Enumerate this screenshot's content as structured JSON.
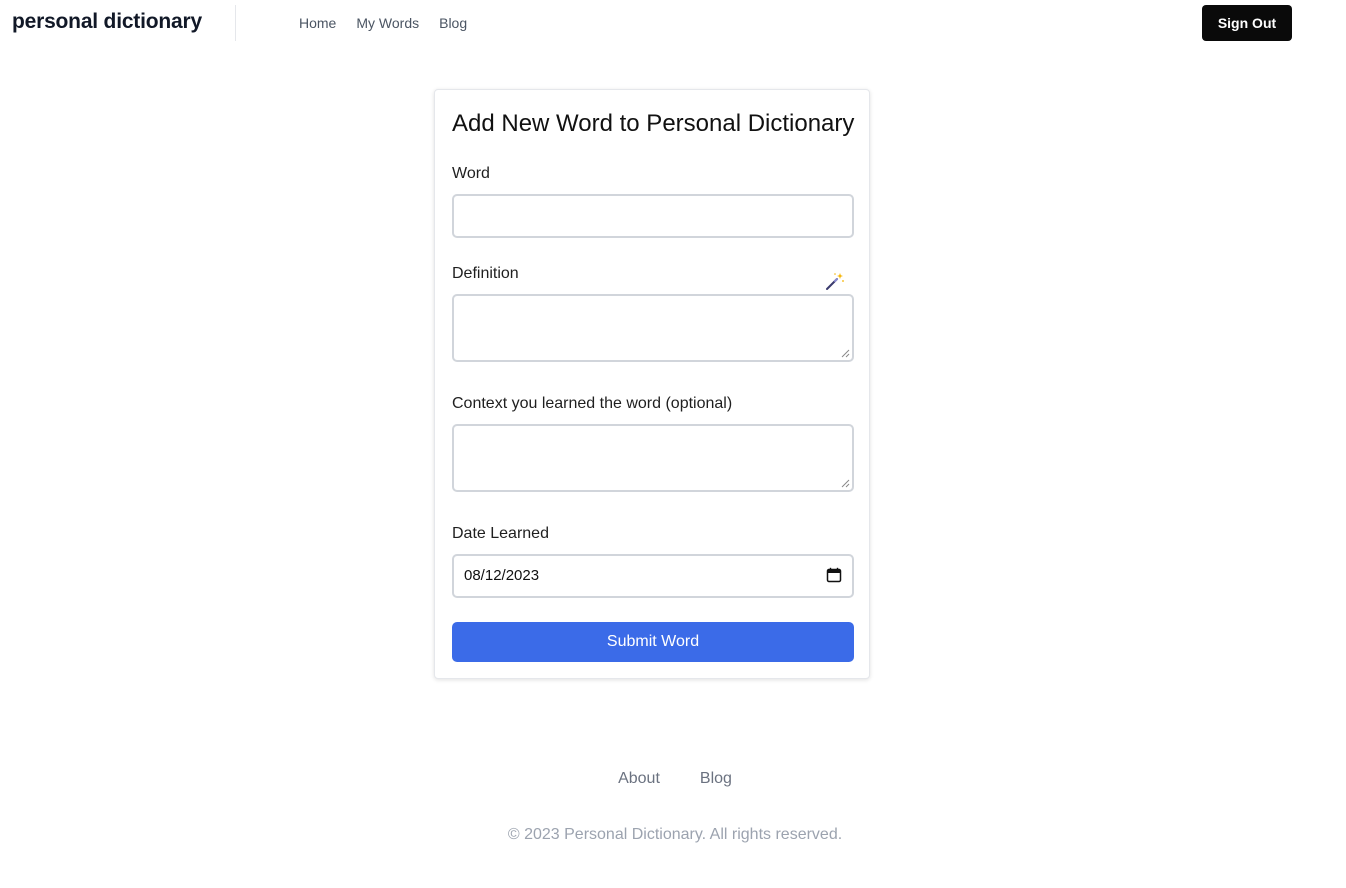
{
  "header": {
    "brand": "personal dictionary",
    "nav": [
      "Home",
      "My Words",
      "Blog"
    ],
    "sign_out_label": "Sign Out"
  },
  "form": {
    "title": "Add New Word to Personal Dictionary",
    "word": {
      "label": "Word",
      "value": ""
    },
    "definition": {
      "label": "Definition",
      "value": "",
      "assist_icon": "magic-wand-icon"
    },
    "context": {
      "label": "Context you learned the word (optional)",
      "value": ""
    },
    "date": {
      "label": "Date Learned",
      "value": "08/12/2023",
      "icon": "calendar-icon"
    },
    "submit_label": "Submit Word"
  },
  "footer": {
    "links": [
      "About",
      "Blog"
    ],
    "copyright": "© 2023 Personal Dictionary. All rights reserved."
  },
  "colors": {
    "accent": "#3b6be8",
    "sign_out_bg": "#0a0a0a"
  }
}
